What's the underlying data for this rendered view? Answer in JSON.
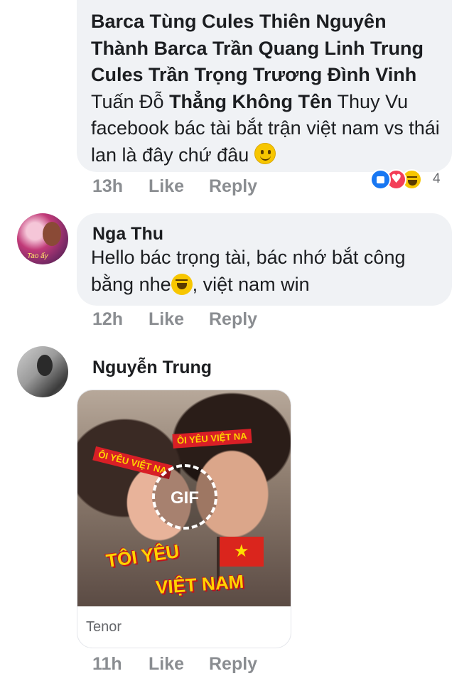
{
  "comments": [
    {
      "author": "",
      "text_parts": [
        "Barca Tùng Cules Thiên Nguyên Thành Barca Trần Quang Linh Trung Cules Trần Trọng Trương Đình Vinh",
        " Tuấn Đỗ ",
        "Thẳng Không Tên",
        " Thuy Vu facebook bác tài bắt trận việt nam vs thái lan là đây chứ đâu "
      ],
      "time": "13h",
      "like_label": "Like",
      "reply_label": "Reply",
      "reaction_count": "4",
      "reactions": [
        "like",
        "love",
        "haha"
      ]
    },
    {
      "author": "Nga Thu",
      "avatar_caption": "Tao ấy",
      "text_before_emoji": "Hello bác trọng tài, bác nhớ bắt công bằng nhe",
      "text_after_emoji": ", việt nam win",
      "time": "12h",
      "like_label": "Like",
      "reply_label": "Reply"
    },
    {
      "author": "Nguyễn Trung",
      "gif": {
        "badge": "GIF",
        "source": "Tenor",
        "headband_text": "ÔI YÊU VIỆT NA",
        "caption_line1": "TÔI YÊU",
        "caption_line2": "VIỆT NAM"
      },
      "time": "11h",
      "like_label": "Like",
      "reply_label": "Reply"
    }
  ],
  "colors": {
    "bubble_bg": "#f0f2f5",
    "meta_text": "#8a8d91",
    "like_blue": "#1877f2",
    "love_red": "#f33e58",
    "haha_yellow": "#f7c600"
  }
}
